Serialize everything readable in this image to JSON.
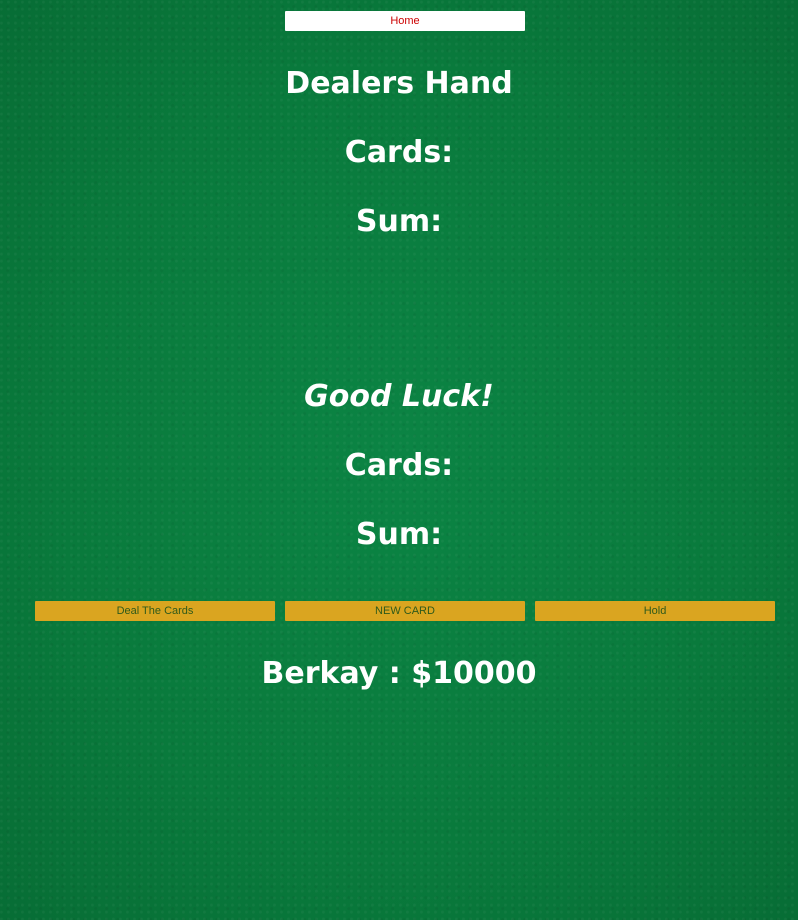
{
  "nav": {
    "home_label": "Home"
  },
  "dealer": {
    "title": "Dealers Hand",
    "cards_label": "Cards:",
    "sum_label": "Sum:"
  },
  "player": {
    "message": "Good Luck!",
    "cards_label": "Cards:",
    "sum_label": "Sum:"
  },
  "actions": {
    "deal_label": "Deal The Cards",
    "new_card_label": "NEW CARD",
    "hold_label": "Hold"
  },
  "account": {
    "text": "Berkay : $10000"
  },
  "colors": {
    "table_green": "#0a7d3e",
    "action_button": "#daa520",
    "home_text": "#cc0000"
  }
}
